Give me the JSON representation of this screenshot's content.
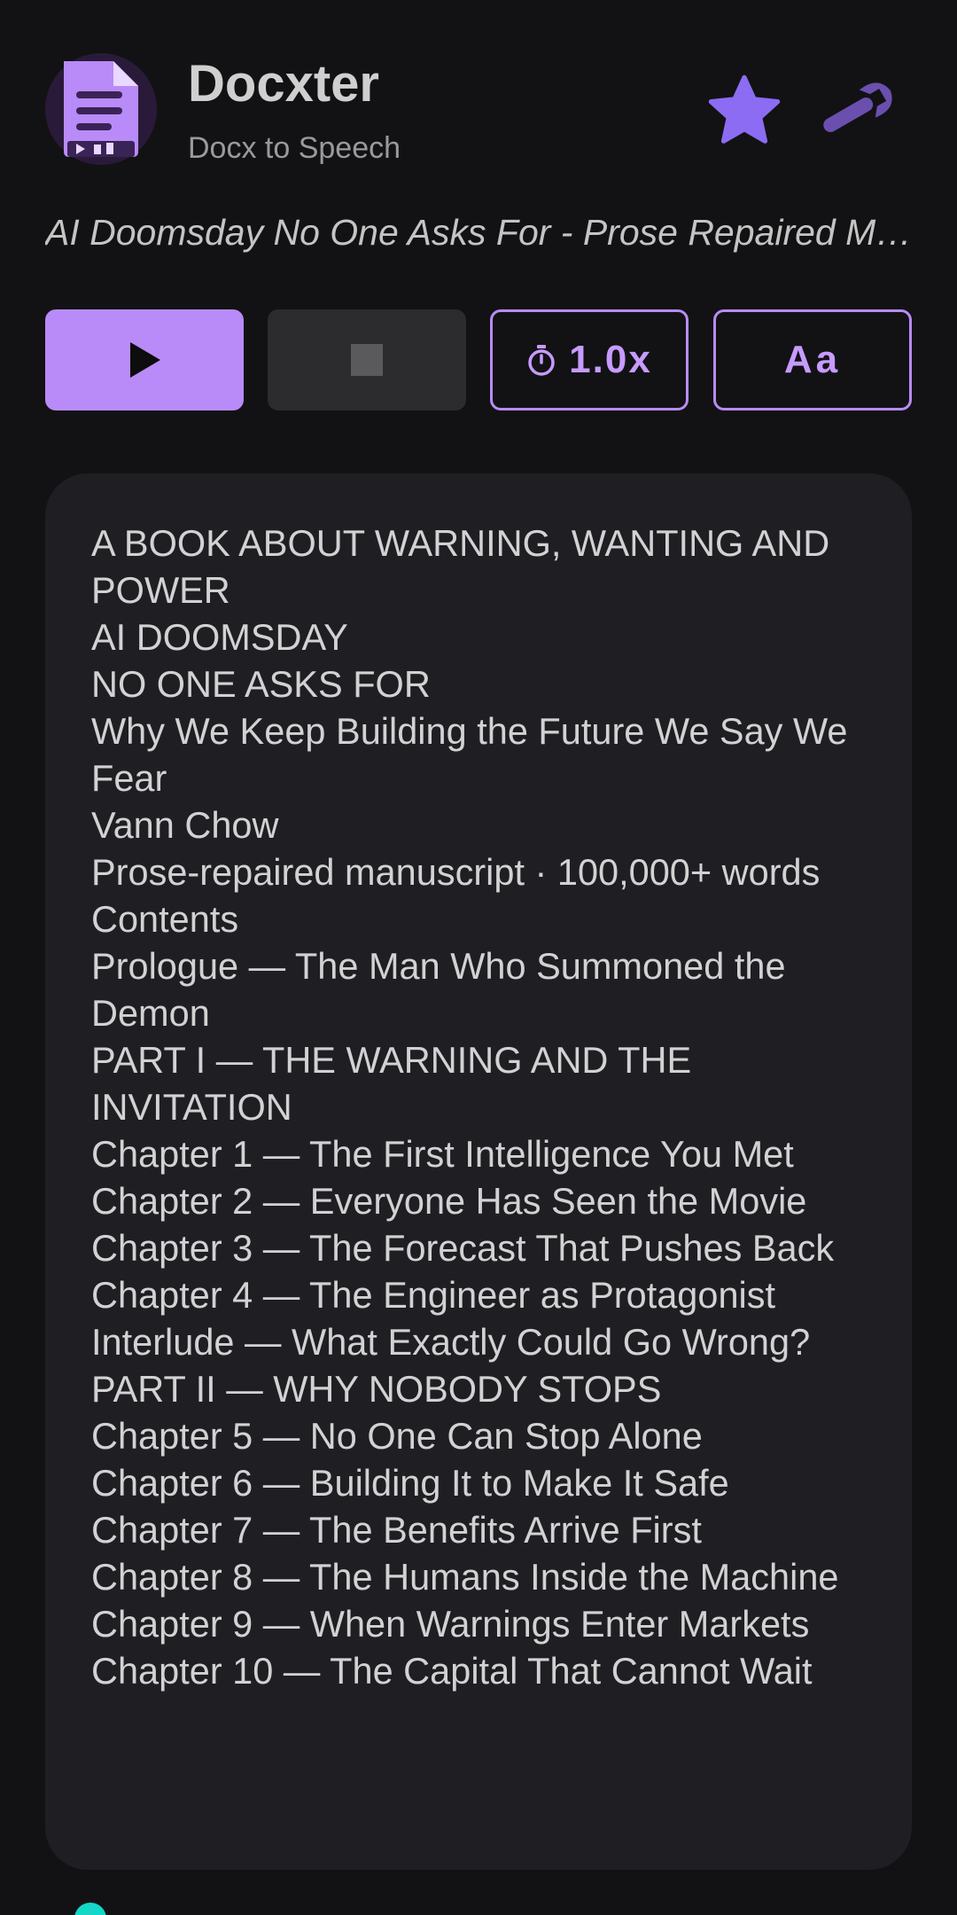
{
  "header": {
    "app_name": "Docxter",
    "app_subtitle": "Docx to Speech",
    "logo_icon": "document-speech-icon",
    "favorite_icon": "star-icon",
    "settings_icon": "wrench-icon"
  },
  "document": {
    "title": "AI Doomsday No One Asks For - Prose Repaired Manuscript"
  },
  "controls": {
    "play_icon": "play-icon",
    "stop_icon": "stop-icon",
    "speed_label": "1.0x",
    "speed_icon": "timer-icon",
    "font_label": "Aa"
  },
  "content": {
    "lines": [
      "A BOOK ABOUT WARNING, WANTING AND POWER",
      "AI DOOMSDAY",
      "NO ONE ASKS FOR",
      "Why We Keep Building the Future We Say We Fear",
      "Vann Chow",
      "Prose-repaired manuscript · 100,000+ words",
      "Contents",
      "Prologue — The Man Who Summoned the Demon",
      "PART I — THE WARNING AND THE INVITATION",
      "Chapter 1 — The First Intelligence You Met",
      "Chapter 2 — Everyone Has Seen the Movie",
      "Chapter 3 — The Forecast That Pushes Back",
      "Chapter 4 — The Engineer as Protagonist",
      "Interlude — What Exactly Could Go Wrong?",
      "PART II — WHY NOBODY STOPS",
      "Chapter 5 — No One Can Stop Alone",
      "Chapter 6 — Building It to Make It Safe",
      "Chapter 7 — The Benefits Arrive First",
      "Chapter 8 — The Humans Inside the Machine",
      "Chapter 9 — When Warnings Enter Markets",
      "Chapter 10 — The Capital That Cannot Wait"
    ]
  },
  "colors": {
    "accent": "#b98bf8",
    "background": "#121214",
    "panel": "#1f1e23",
    "indicator": "#14d7c8"
  }
}
